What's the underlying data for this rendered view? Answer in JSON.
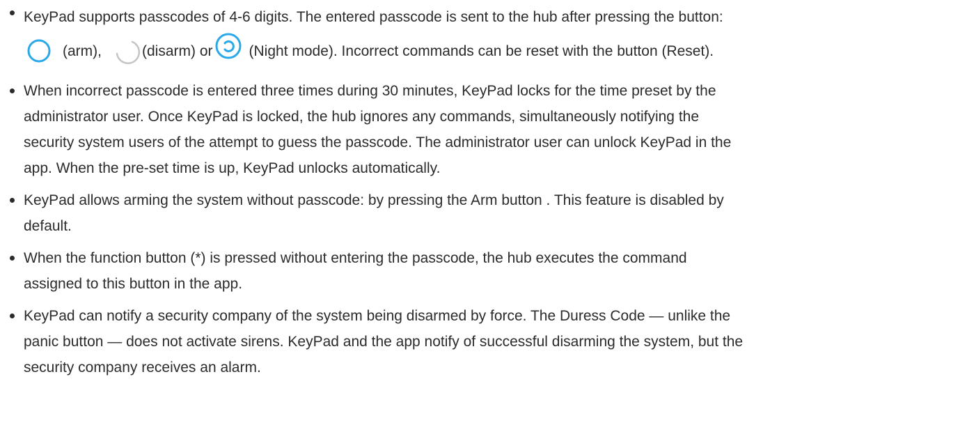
{
  "bullets": [
    {
      "line1": "KeyPad supports passcodes of 4-6 digits. The entered passcode is sent to the hub after pressing the button:",
      "arm_text": "(arm),",
      "disarm_text": "(disarm) or",
      "night_text": "(Night mode). Incorrect commands can be reset with the button (Reset).",
      "icons": [
        "arm-circle-icon",
        "disarm-arc-icon",
        "night-mode-icon"
      ],
      "icon_colors": {
        "arm": "#2aa8e8",
        "disarm": "#c4c4c4",
        "night": "#2aa8e8"
      }
    },
    {
      "lines": [
        "When incorrect passcode is entered three times during 30 minutes, KeyPad locks for the time preset by the",
        "administrator user. Once KeyPad is locked, the hub ignores any commands, simultaneously notifying the",
        "security system users of the attempt to guess the passcode. The administrator user can unlock KeyPad in the",
        "app. When the pre-set time is up, KeyPad unlocks automatically."
      ]
    },
    {
      "lines": [
        "KeyPad allows arming the system without passcode: by pressing the Arm button . This feature is disabled by",
        "default."
      ]
    },
    {
      "lines": [
        "When the function button (*) is pressed without entering the passcode, the hub executes the command",
        "assigned to this button in the app."
      ]
    },
    {
      "lines": [
        "KeyPad can notify a security company of the system being disarmed by force. The Duress Code — unlike the",
        "panic button — does not activate sirens. KeyPad and the app notify of successful disarming the system, but the",
        "security company receives an alarm."
      ]
    }
  ]
}
